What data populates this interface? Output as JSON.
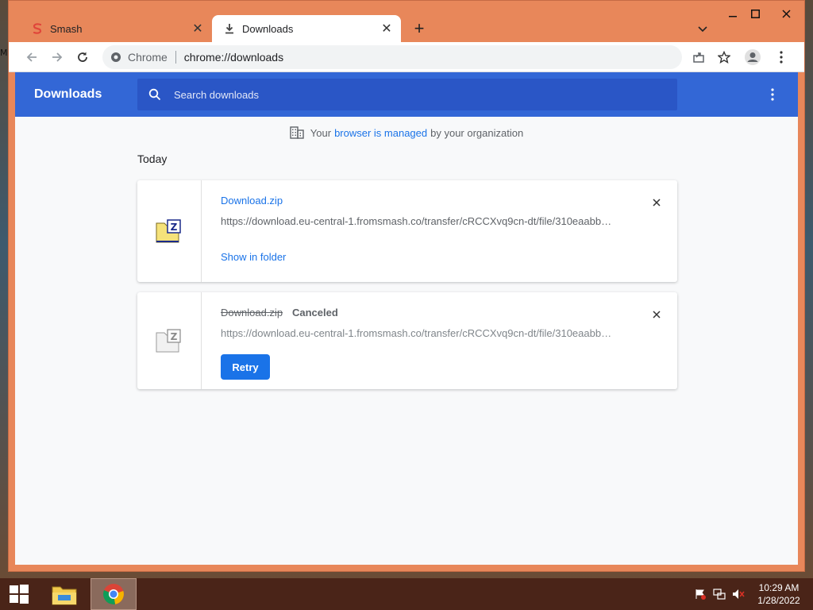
{
  "window": {
    "tabs": [
      {
        "label": "Smash",
        "active": false,
        "icon": "smash-logo"
      },
      {
        "label": "Downloads",
        "active": true,
        "icon": "download-icon"
      }
    ],
    "new_tab": "+"
  },
  "toolbar": {
    "chip_label": "Chrome",
    "url": "chrome://downloads"
  },
  "downloads_page": {
    "title": "Downloads",
    "search_placeholder": "Search downloads",
    "managed_notice": {
      "prefix": "Your",
      "link": "browser is managed",
      "suffix": "by your organization"
    },
    "section_heading": "Today",
    "items": [
      {
        "filename": "Download.zip",
        "url": "https://download.eu-central-1.fromsmash.co/transfer/cRCCXvq9cn-dt/file/310eaabb…",
        "action": "Show in folder",
        "status": ""
      },
      {
        "filename": "Download.zip",
        "url": "https://download.eu-central-1.fromsmash.co/transfer/cRCCXvq9cn-dt/file/310eaabb…",
        "status": "Canceled",
        "action": "Retry"
      }
    ]
  },
  "taskbar": {
    "time": "10:29 AM",
    "date": "1/28/2022"
  },
  "colors": {
    "header_blue": "#3367d6",
    "link_blue": "#1a73e8",
    "window_frame": "#e8875a"
  }
}
